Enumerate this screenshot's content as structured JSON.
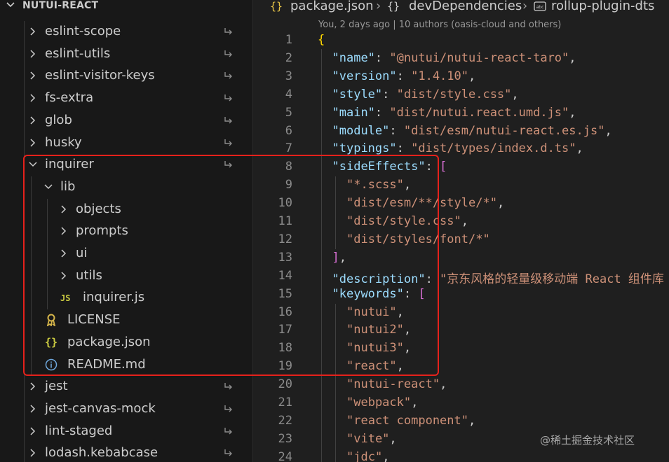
{
  "explorer": {
    "root_label": "NUTUI-REACT",
    "items": [
      {
        "label": "eslint-scope",
        "kind": "folder",
        "state": "collapsed",
        "symlink": true
      },
      {
        "label": "eslint-utils",
        "kind": "folder",
        "state": "collapsed",
        "symlink": true
      },
      {
        "label": "eslint-visitor-keys",
        "kind": "folder",
        "state": "collapsed",
        "symlink": true
      },
      {
        "label": "fs-extra",
        "kind": "folder",
        "state": "collapsed",
        "symlink": true
      },
      {
        "label": "glob",
        "kind": "folder",
        "state": "collapsed",
        "symlink": true
      },
      {
        "label": "husky",
        "kind": "folder",
        "state": "collapsed",
        "symlink": true
      },
      {
        "label": "inquirer",
        "kind": "folder",
        "state": "expanded",
        "symlink": true
      },
      {
        "label": "lib",
        "kind": "folder",
        "state": "expanded",
        "symlink": false
      },
      {
        "label": "objects",
        "kind": "folder",
        "state": "collapsed",
        "symlink": false
      },
      {
        "label": "prompts",
        "kind": "folder",
        "state": "collapsed",
        "symlink": false
      },
      {
        "label": "ui",
        "kind": "folder",
        "state": "collapsed",
        "symlink": false
      },
      {
        "label": "utils",
        "kind": "folder",
        "state": "collapsed",
        "symlink": false
      },
      {
        "label": "inquirer.js",
        "kind": "file",
        "icon": "js-icon",
        "icon_text": "JS",
        "symlink": false
      },
      {
        "label": "LICENSE",
        "kind": "file",
        "icon": "license-icon",
        "symlink": false
      },
      {
        "label": "package.json",
        "kind": "file",
        "icon": "json-icon",
        "icon_text": "{}",
        "symlink": false
      },
      {
        "label": "README.md",
        "kind": "file",
        "icon": "info-icon",
        "symlink": false
      },
      {
        "label": "jest",
        "kind": "folder",
        "state": "collapsed",
        "symlink": true
      },
      {
        "label": "jest-canvas-mock",
        "kind": "folder",
        "state": "collapsed",
        "symlink": true
      },
      {
        "label": "lint-staged",
        "kind": "folder",
        "state": "collapsed",
        "symlink": true
      },
      {
        "label": "lodash.kebabcase",
        "kind": "folder",
        "state": "collapsed",
        "symlink": true
      }
    ]
  },
  "breadcrumb": {
    "file": "package.json",
    "section": "devDependencies",
    "key": "rollup-plugin-dts",
    "file_icon": "{}",
    "section_icon": "{}"
  },
  "codelens": "You, 2 days ago | 10 authors (oasis-cloud and others)",
  "code": [
    {
      "n": "1",
      "tokens": [
        {
          "t": "{",
          "c": "b1"
        }
      ]
    },
    {
      "n": "2",
      "tokens": [
        {
          "t": "\"name\"",
          "c": "k"
        },
        {
          "t": ": ",
          "c": "p"
        },
        {
          "t": "\"@nutui/nutui-react-taro\"",
          "c": "s"
        },
        {
          "t": ",",
          "c": "p"
        }
      ]
    },
    {
      "n": "3",
      "tokens": [
        {
          "t": "\"version\"",
          "c": "k"
        },
        {
          "t": ": ",
          "c": "p"
        },
        {
          "t": "\"1.4.10\"",
          "c": "s"
        },
        {
          "t": ",",
          "c": "p"
        }
      ]
    },
    {
      "n": "4",
      "tokens": [
        {
          "t": "\"style\"",
          "c": "k"
        },
        {
          "t": ": ",
          "c": "p"
        },
        {
          "t": "\"dist/style.css\"",
          "c": "s"
        },
        {
          "t": ",",
          "c": "p"
        }
      ]
    },
    {
      "n": "5",
      "tokens": [
        {
          "t": "\"main\"",
          "c": "k"
        },
        {
          "t": ": ",
          "c": "p"
        },
        {
          "t": "\"dist/nutui.react.umd.js\"",
          "c": "s"
        },
        {
          "t": ",",
          "c": "p"
        }
      ]
    },
    {
      "n": "6",
      "tokens": [
        {
          "t": "\"module\"",
          "c": "k"
        },
        {
          "t": ": ",
          "c": "p"
        },
        {
          "t": "\"dist/esm/nutui-react.es.js\"",
          "c": "s"
        },
        {
          "t": ",",
          "c": "p"
        }
      ]
    },
    {
      "n": "7",
      "tokens": [
        {
          "t": "\"typings\"",
          "c": "k"
        },
        {
          "t": ": ",
          "c": "p"
        },
        {
          "t": "\"dist/types/index.d.ts\"",
          "c": "s"
        },
        {
          "t": ",",
          "c": "p"
        }
      ]
    },
    {
      "n": "8",
      "tokens": [
        {
          "t": "\"sideEffects\"",
          "c": "k"
        },
        {
          "t": ": ",
          "c": "p"
        },
        {
          "t": "[",
          "c": "b2"
        }
      ]
    },
    {
      "n": "9",
      "tokens": [
        {
          "t": "\"*.scss\"",
          "c": "s"
        },
        {
          "t": ",",
          "c": "p"
        }
      ]
    },
    {
      "n": "10",
      "tokens": [
        {
          "t": "\"dist/esm/**/style/*\"",
          "c": "s"
        },
        {
          "t": ",",
          "c": "p"
        }
      ]
    },
    {
      "n": "11",
      "tokens": [
        {
          "t": "\"dist/style.css\"",
          "c": "s"
        },
        {
          "t": ",",
          "c": "p"
        }
      ]
    },
    {
      "n": "12",
      "tokens": [
        {
          "t": "\"dist/styles/font/*\"",
          "c": "s"
        }
      ]
    },
    {
      "n": "13",
      "tokens": [
        {
          "t": "]",
          "c": "b2"
        },
        {
          "t": ",",
          "c": "p"
        }
      ]
    },
    {
      "n": "14",
      "tokens": [
        {
          "t": "\"description\"",
          "c": "k"
        },
        {
          "t": ": ",
          "c": "p"
        },
        {
          "t": "\"京东风格的轻量级移动端 React 组件库",
          "c": "s"
        }
      ]
    },
    {
      "n": "15",
      "tokens": [
        {
          "t": "\"keywords\"",
          "c": "k"
        },
        {
          "t": ": ",
          "c": "p"
        },
        {
          "t": "[",
          "c": "b2"
        }
      ]
    },
    {
      "n": "16",
      "tokens": [
        {
          "t": "\"nutui\"",
          "c": "s"
        },
        {
          "t": ",",
          "c": "p"
        }
      ]
    },
    {
      "n": "17",
      "tokens": [
        {
          "t": "\"nutui2\"",
          "c": "s"
        },
        {
          "t": ",",
          "c": "p"
        }
      ]
    },
    {
      "n": "18",
      "tokens": [
        {
          "t": "\"nutui3\"",
          "c": "s"
        },
        {
          "t": ",",
          "c": "p"
        }
      ]
    },
    {
      "n": "19",
      "tokens": [
        {
          "t": "\"react\"",
          "c": "s"
        },
        {
          "t": ",",
          "c": "p"
        }
      ]
    },
    {
      "n": "20",
      "tokens": [
        {
          "t": "\"nutui-react\"",
          "c": "s"
        },
        {
          "t": ",",
          "c": "p"
        }
      ]
    },
    {
      "n": "21",
      "tokens": [
        {
          "t": "\"webpack\"",
          "c": "s"
        },
        {
          "t": ",",
          "c": "p"
        }
      ]
    },
    {
      "n": "22",
      "tokens": [
        {
          "t": "\"react component\"",
          "c": "s"
        },
        {
          "t": ",",
          "c": "p"
        }
      ]
    },
    {
      "n": "23",
      "tokens": [
        {
          "t": "\"vite\"",
          "c": "s"
        },
        {
          "t": ",",
          "c": "p"
        }
      ]
    },
    {
      "n": "24",
      "tokens": [
        {
          "t": "\"jdc\"",
          "c": "s"
        },
        {
          "t": ",",
          "c": "p"
        }
      ]
    }
  ],
  "watermark": "@稀土掘金技术社区",
  "colors": {
    "highlight_box": "#e5211b",
    "json_key": "#9cdcfe",
    "json_string": "#ce9178",
    "bracket_gold": "#ffd700",
    "bracket_purple": "#da70d6"
  }
}
